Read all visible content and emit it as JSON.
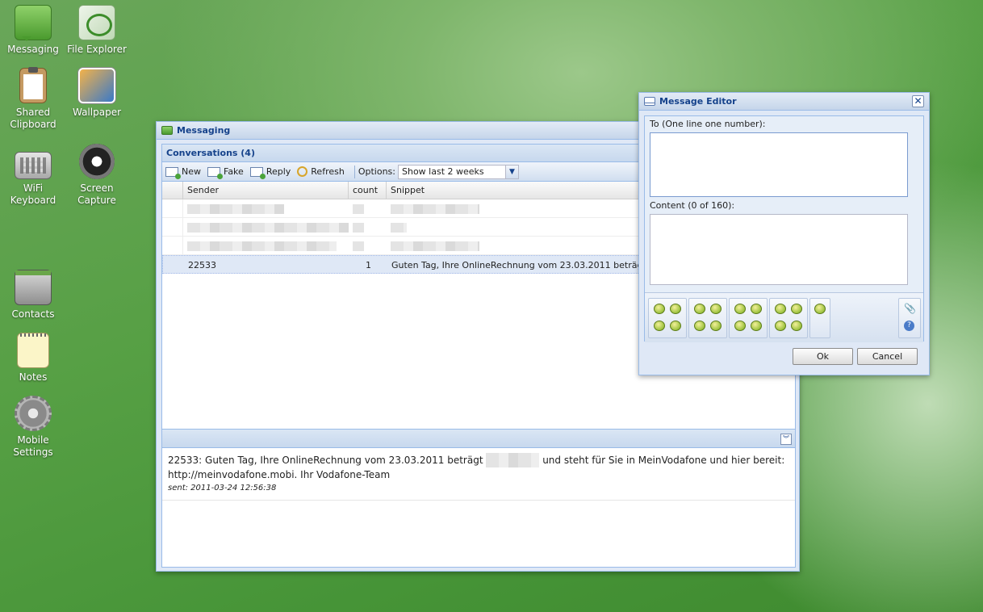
{
  "desktop": {
    "icons": [
      {
        "label": "Messaging",
        "icon": "messaging-icon"
      },
      {
        "label": "File Explorer",
        "icon": "file-explorer-icon"
      },
      {
        "label": "Shared Clipboard",
        "icon": "clipboard-icon"
      },
      {
        "label": "Wallpaper",
        "icon": "wallpaper-icon"
      },
      {
        "label": "WiFi Keyboard",
        "icon": "keyboard-icon"
      },
      {
        "label": "Screen Capture",
        "icon": "camera-icon"
      },
      {
        "label": "Contacts",
        "icon": "contacts-icon"
      },
      {
        "label": "Notes",
        "icon": "notes-icon"
      },
      {
        "label": "Mobile Settings",
        "icon": "gear-icon"
      }
    ]
  },
  "messaging": {
    "title": "Messaging",
    "conversations_header": "Conversations (4)",
    "toolbar": {
      "new": "New",
      "fake": "Fake",
      "reply": "Reply",
      "refresh": "Refresh",
      "options_label": "Options:",
      "options_value": "Show last 2 weeks"
    },
    "columns": {
      "sender": "Sender",
      "count": "count",
      "snippet": "Snippet"
    },
    "rows": [
      {
        "sender": "22533",
        "count": "1",
        "snippet": "Guten Tag, Ihre OnlineRechnung vom 23.03.2011 beträgt"
      }
    ],
    "detail": {
      "text_before": "22533: Guten Tag, Ihre OnlineRechnung vom 23.03.2011 beträgt",
      "text_after": "und steht für Sie in MeinVodafone und hier bereit:",
      "text_line2": "http://meinvodafone.mobi. Ihr Vodafone-Team",
      "sent": "sent: 2011-03-24 12:56:38"
    }
  },
  "editor": {
    "title": "Message Editor",
    "close": "✕",
    "to_label": "To (One line one number):",
    "to_value": "",
    "content_label": "Content (0 of 160):",
    "content_value": "",
    "ok": "Ok",
    "cancel": "Cancel"
  },
  "colors": {
    "accent": "#15428b",
    "window_border": "#99bbe8"
  }
}
